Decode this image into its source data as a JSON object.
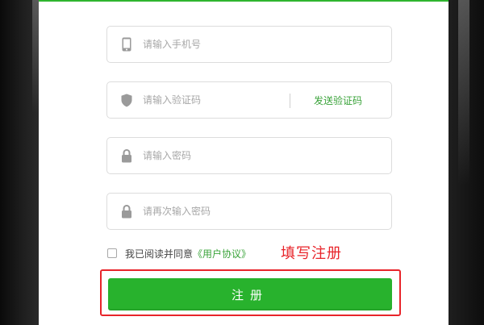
{
  "form": {
    "phone_placeholder": "请输入手机号",
    "code_placeholder": "请输入验证码",
    "send_code_label": "发送验证码",
    "password_placeholder": "请输入密码",
    "confirm_password_placeholder": "请再次输入密码",
    "agree_prefix": "我已阅读并同意",
    "agreement_link": "《用户协议》",
    "register_label": "注册"
  },
  "annotation": {
    "text": "填写注册"
  },
  "icons": {
    "phone": "phone-icon",
    "shield": "shield-icon",
    "lock": "lock-icon"
  },
  "colors": {
    "accent_green": "#28b22d",
    "link_green": "#3aa33a",
    "annotation_red": "#e8242a"
  }
}
